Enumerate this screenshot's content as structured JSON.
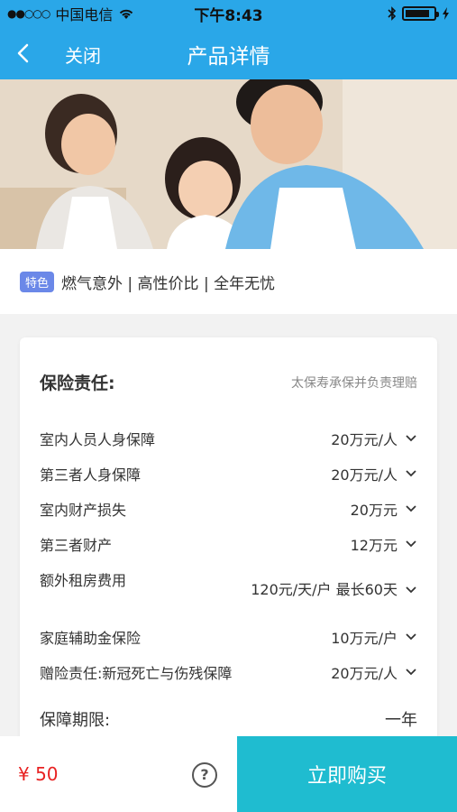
{
  "status": {
    "signal": "●●○○○",
    "carrier": "中国电信",
    "time": "下午8:43"
  },
  "nav": {
    "close": "关闭",
    "title": "产品详情"
  },
  "feature": {
    "tag": "特色",
    "text": "燃气意外 | 高性价比 | 全年无忧"
  },
  "card": {
    "title": "保险责任:",
    "subtitle": "太保寿承保并负责理赔",
    "rows": [
      {
        "label": "室内人员人身保障",
        "value": "20万元/人"
      },
      {
        "label": "第三者人身保障",
        "value": "20万元/人"
      },
      {
        "label": "室内财产损失",
        "value": "20万元"
      },
      {
        "label": "第三者财产",
        "value": "12万元"
      },
      {
        "label": "额外租房费用",
        "value": "120元/天/户 最长60天"
      },
      {
        "label": "家庭辅助金保险",
        "value": "10万元/户"
      },
      {
        "label": "赠险责任:新冠死亡与伤残保障",
        "value": "20万元/人"
      }
    ],
    "period_label": "保障期限:",
    "period_value": "一年"
  },
  "bottom": {
    "price": "¥ 50",
    "help": "?",
    "buy": "立即购买"
  }
}
